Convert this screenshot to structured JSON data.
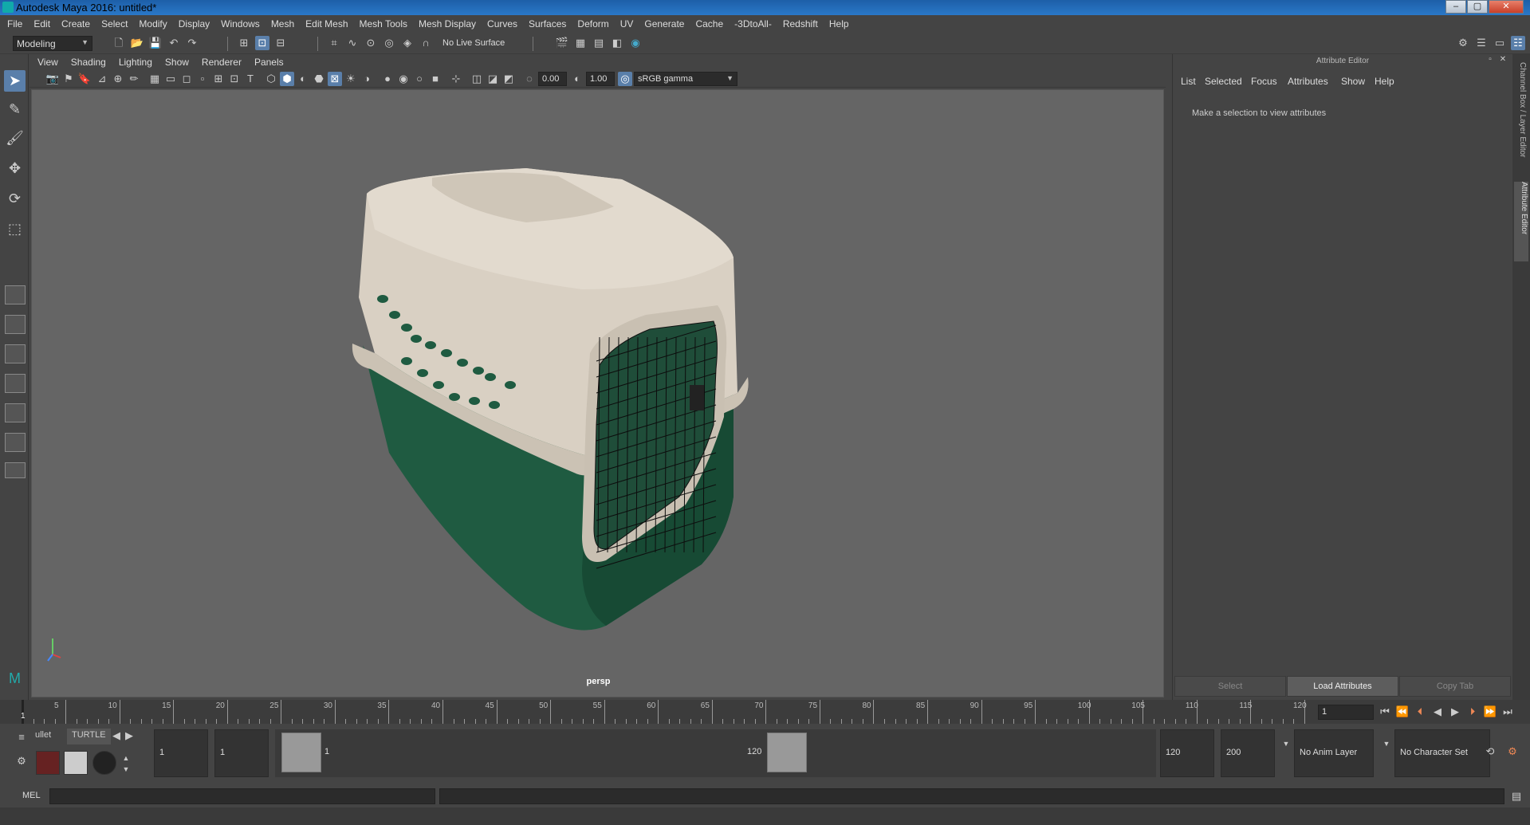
{
  "window": {
    "title": "Autodesk Maya 2016: untitled*"
  },
  "menubar": [
    "File",
    "Edit",
    "Create",
    "Select",
    "Modify",
    "Display",
    "Windows",
    "Mesh",
    "Edit Mesh",
    "Mesh Tools",
    "Mesh Display",
    "Curves",
    "Surfaces",
    "Deform",
    "UV",
    "Generate",
    "Cache",
    "-3DtoAll-",
    "Redshift",
    "Help"
  ],
  "statusline": {
    "mode": "Modeling",
    "live_surface": "No Live Surface"
  },
  "viewport": {
    "menu": [
      "View",
      "Shading",
      "Lighting",
      "Show",
      "Renderer",
      "Panels"
    ],
    "exposure": "0.00",
    "gamma": "1.00",
    "color_space": "sRGB gamma",
    "camera_label": "persp"
  },
  "attribute_editor": {
    "title": "Attribute Editor",
    "tabs": [
      "List",
      "Selected",
      "Focus",
      "Attributes",
      "Show",
      "Help"
    ],
    "message": "Make a selection to view attributes",
    "buttons": {
      "select": "Select",
      "load": "Load Attributes",
      "copy": "Copy Tab"
    }
  },
  "side_tabs": {
    "channel_box": "Channel Box / Layer Editor",
    "attribute_editor": "Attribute Editor"
  },
  "timeline": {
    "ticks": [
      5,
      10,
      15,
      20,
      25,
      30,
      35,
      40,
      45,
      50,
      55,
      60,
      65,
      70,
      75,
      80,
      85,
      90,
      95,
      100,
      105,
      110,
      115,
      120
    ],
    "start_label": "1",
    "current_frame": "1"
  },
  "range": {
    "shelf_tabs": [
      "ullet",
      "TURTLE"
    ],
    "start": "1",
    "playback_start": "1",
    "slider_start": "1",
    "slider_end": "120",
    "playback_end": "120",
    "end": "200",
    "anim_layer": "No Anim Layer",
    "character_set": "No Character Set"
  },
  "cmdline": {
    "label": "MEL"
  },
  "colors": {
    "crate_top": "#d9d0c3",
    "crate_base": "#1f5b41",
    "viewport_bg": "#656565",
    "accent": "#5a7faa"
  }
}
